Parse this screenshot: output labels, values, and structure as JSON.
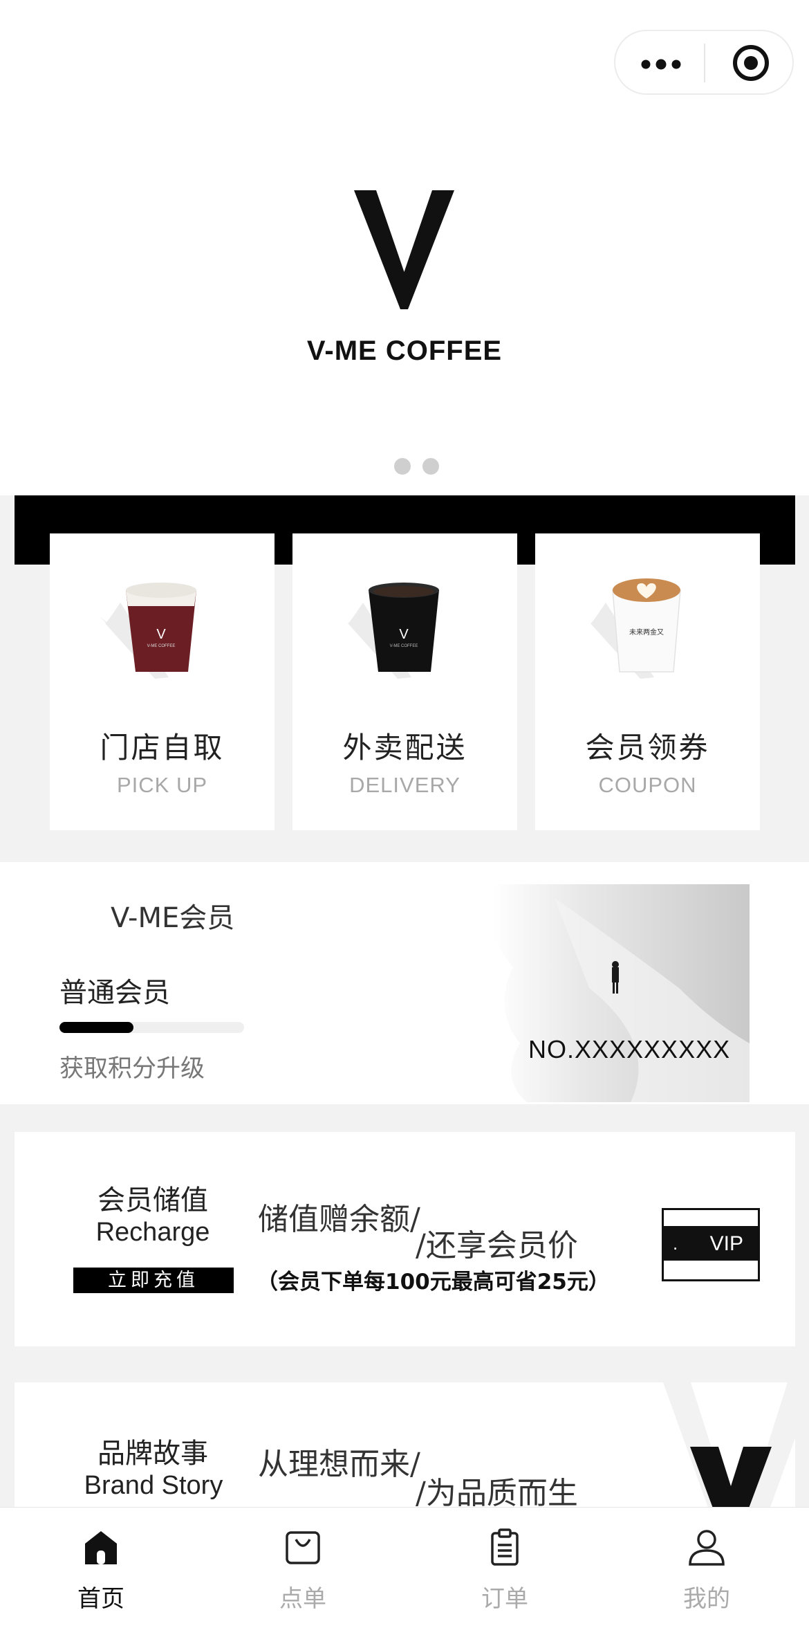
{
  "brand": {
    "name": "V-ME COFFEE"
  },
  "colors": {
    "primary": "#000000",
    "muted": "#a8a8a8",
    "background": "#f2f2f2"
  },
  "header": {
    "menu_icon": "more-dots-icon",
    "close_icon": "target-circle-icon"
  },
  "carousel": {
    "page_count": 2
  },
  "services": [
    {
      "title": "门店自取",
      "subtitle": "PICK UP",
      "icon": "iced-coffee-cup"
    },
    {
      "title": "外卖配送",
      "subtitle": "DELIVERY",
      "icon": "black-coffee-cup"
    },
    {
      "title": "会员领券",
      "subtitle": "COUPON",
      "icon": "latte-cup"
    }
  ],
  "member": {
    "label": "V-ME会员",
    "level": "普通会员",
    "progress_fraction": 0.4,
    "hint": "获取积分升级",
    "card_number": "NO.XXXXXXXXX"
  },
  "recharge": {
    "title": "会员储值",
    "title_en": "Recharge",
    "button": "立即充值",
    "slogan_1": "储值赠余额/",
    "slogan_2": "/还享会员价",
    "note": "（会员下单每100元最高可省25元）",
    "card_label": "VIP",
    "card_dot": "."
  },
  "story": {
    "title": "品牌故事",
    "title_en": "Brand Story",
    "slogan_1": "从理想而来/",
    "slogan_2": "/为品质而生"
  },
  "tabs": [
    {
      "label": "首页",
      "icon": "home-icon",
      "active": true
    },
    {
      "label": "点单",
      "icon": "shopping-bag-icon",
      "active": false
    },
    {
      "label": "订单",
      "icon": "clipboard-icon",
      "active": false
    },
    {
      "label": "我的",
      "icon": "user-icon",
      "active": false
    }
  ]
}
